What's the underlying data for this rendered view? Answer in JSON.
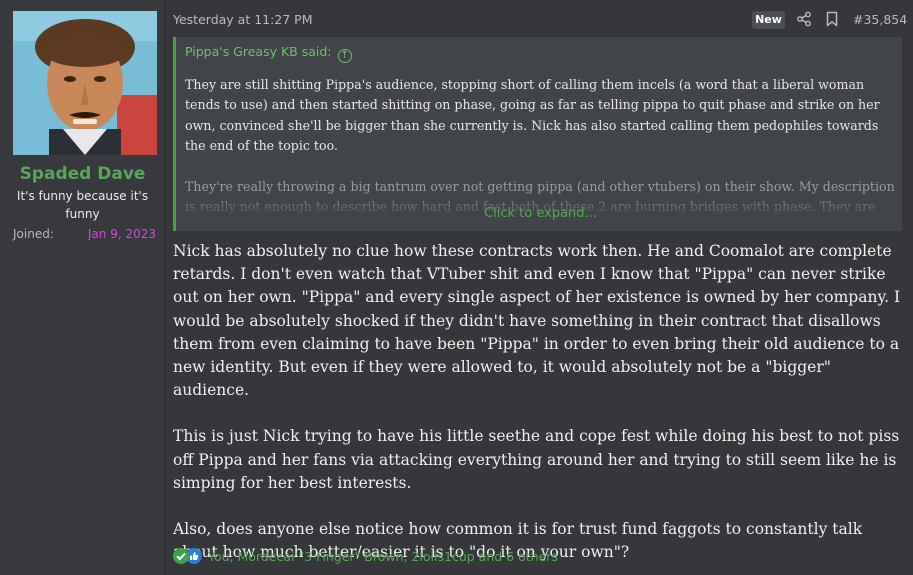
{
  "user": {
    "name": "Spaded Dave",
    "title": "It's funny because it's funny",
    "joined_label": "Joined:",
    "joined_date": "Jan 9, 2023"
  },
  "header": {
    "timestamp": "Yesterday at 11:27 PM",
    "badge": "New",
    "post_number": "#35,854",
    "icons": [
      "share-icon",
      "bookmark-icon"
    ]
  },
  "quote": {
    "author": "Pippa's Greasy KB said:",
    "paragraphs": [
      "They are still shitting Pippa's audience, stopping short of calling them incels (a word that a liberal woman tends to use) and then started shitting on phase, going as far as telling pippa to quit phase and strike on her own, convinced she'll be bigger than she currently is. Nick has also started calling them pedophiles towards the end of the topic too.",
      "They're really throwing a big tantrum over not getting pippa (and other vtubers) on their show. My description is really not enough to describe how hard and fast both of these 2 are burning bridges with phase. They are"
    ],
    "expand_label": "Click to expand..."
  },
  "body": {
    "paragraphs": [
      "Nick has absolutely no clue how these contracts work then. He and Coomalot are complete retards. I don't even watch that VTuber shit and even I know that \"Pippa\" can never strike out on her own. \"Pippa\" and every single aspect of her existence is owned by her company. I would be absolutely shocked if they didn't have something in their contract that disallows them from even claiming to have been \"Pippa\" in order to even bring their old audience to a new identity. But even if they were allowed to, it would absolutely not be a \"bigger\" audience.",
      "This is just Nick trying to have his little seethe and cope fest while doing his best to not piss off Pippa and her fans via attacking everything around her and trying to still seem like he is simping for her best interests.",
      "Also, does anyone else notice how common it is for trust fund faggots to constantly talk about how much better/easier it is to \"do it on your own\"?"
    ]
  },
  "reactions": {
    "icons": [
      "check-reaction-icon",
      "like-reaction-icon"
    ],
    "text": "You, Mordecai \"3 Finger\" Brown, 2lolis1cup and 6 others"
  },
  "colors": {
    "username": "#5aa55a",
    "joined_date": "#d845d8",
    "quote_accent": "#4b9e4b",
    "background": "#35373b"
  }
}
